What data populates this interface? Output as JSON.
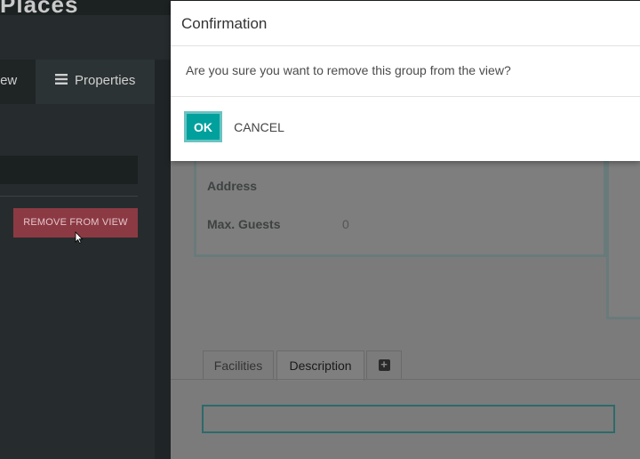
{
  "app": {
    "title": "Places"
  },
  "sidebar": {
    "tabs": [
      {
        "label": "View"
      },
      {
        "label": "Properties",
        "icon": "list-icon"
      }
    ],
    "remove_button": "REMOVE FROM VIEW"
  },
  "form": {
    "fields": [
      {
        "label": "Address",
        "value": ""
      },
      {
        "label": "Max. Guests",
        "value": "0"
      }
    ],
    "notebook_tabs": [
      {
        "label": "Facilities"
      },
      {
        "label": "Description",
        "active": true
      }
    ],
    "add_tab_icon": "plus-square-icon"
  },
  "dialog": {
    "title": "Confirmation",
    "message": "Are you sure you want to remove this group from the view?",
    "ok_label": "OK",
    "cancel_label": "CANCEL",
    "accent_color": "#00a09d"
  }
}
